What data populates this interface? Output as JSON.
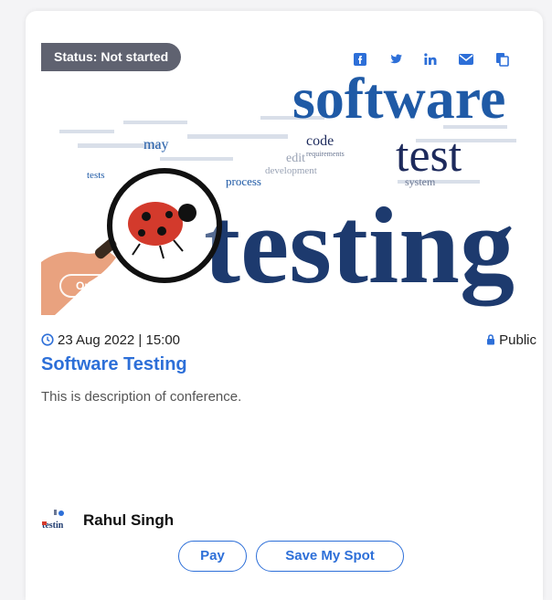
{
  "card": {
    "status_badge": "Status: Not started",
    "online_badge": "Online",
    "date_time": "23 Aug 2022 | 15:00",
    "visibility": "Public",
    "title": "Software Testing",
    "description": "This is description of conference.",
    "host_name": "Rahul Singh",
    "pay_label": "Pay",
    "save_label": "Save My Spot"
  },
  "banner": {
    "word_software": "software",
    "word_test": "test",
    "word_testing": "testing",
    "words_small": [
      "may",
      "code",
      "edit",
      "tests",
      "process",
      "system",
      "development",
      "requirements"
    ],
    "color_main": "#1f5aa6",
    "color_dark": "#1d2a5c"
  },
  "share": {
    "items": [
      "facebook-icon",
      "twitter-icon",
      "linkedin-icon",
      "email-icon",
      "copy-icon"
    ],
    "icon_color": "#2d6fd8"
  },
  "avatar_text": "testin"
}
